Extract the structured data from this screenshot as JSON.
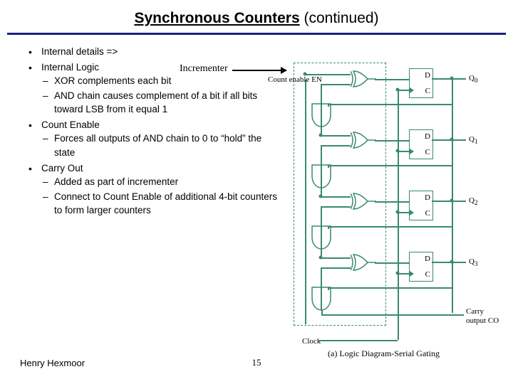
{
  "title_main": "Synchronous Counters",
  "title_cont": "(continued)",
  "incrementer_label": "Incrementer",
  "bullets": {
    "b0": "Internal details =>",
    "b1": "Internal Logic",
    "b1s": {
      "s0": "XOR complements each bit",
      "s1": "AND chain causes complement of a bit if all bits toward LSB from it equal 1"
    },
    "b2": "Count Enable",
    "b2s": {
      "s0": "Forces all outputs of AND chain to 0 to “hold” the state"
    },
    "b3": "Carry Out",
    "b3s": {
      "s0": "Added as part of  incrementer",
      "s1": "Connect to Count Enable of additional 4-bit counters to form larger counters"
    }
  },
  "diagram": {
    "count_enable": "Count enable EN",
    "clock": "Clock",
    "q": [
      "Q",
      "Q",
      "Q",
      "Q"
    ],
    "qsub": [
      "0",
      "1",
      "2",
      "3"
    ],
    "d": "D",
    "c": "C",
    "carry_out": "Carry",
    "carry_out2": "output CO",
    "caption": "(a) Logic Diagram-Serial Gating"
  },
  "footer": {
    "author": "Henry Hexmoor",
    "page": "15"
  }
}
